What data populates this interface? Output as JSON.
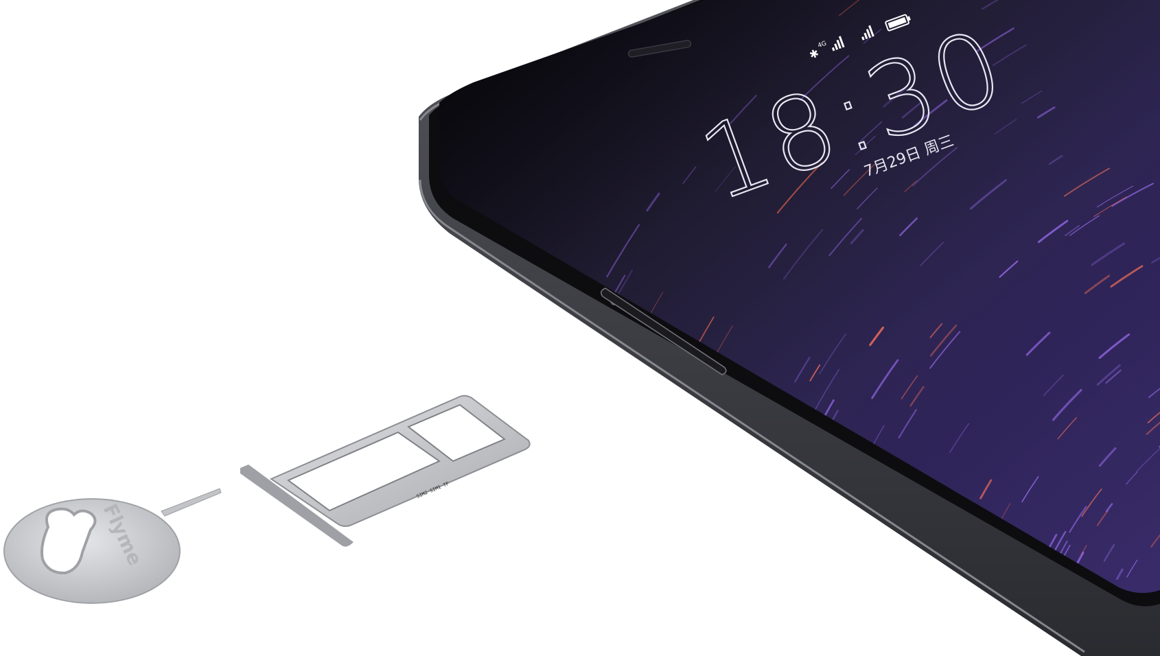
{
  "lock_screen": {
    "time": "18:30",
    "date": "7月29日 周三"
  },
  "status_bar": {
    "network_label": "4G",
    "icons": [
      "bluetooth-icon",
      "signal-icon",
      "signal-icon",
      "battery-icon"
    ]
  },
  "sim_tool": {
    "brand": "Flyme"
  },
  "sim_tray": {
    "engraving": "SIM2 SIM1 TF"
  },
  "colors": {
    "background": "#ffffff",
    "phone_body": "#3a3b40",
    "screen_bg": "#2b2352",
    "streak_violet": "#8a62d8",
    "streak_red": "#e0685a",
    "metal": "#c9cbcf"
  }
}
